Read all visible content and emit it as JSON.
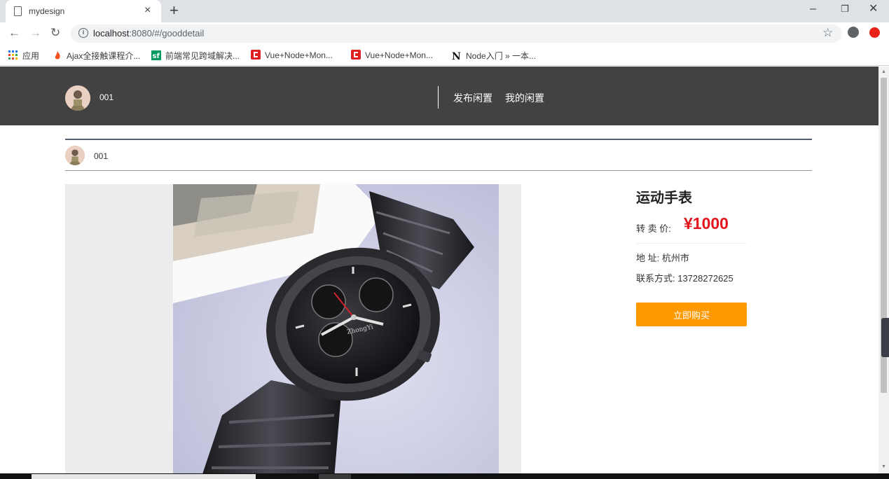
{
  "browser": {
    "tab_title": "mydesign",
    "url_host": "localhost",
    "url_path": ":8080/#/gooddetail",
    "bookmarks": [
      {
        "label": "应用",
        "icon": "apps-grid-icon",
        "color": "#1a73e8"
      },
      {
        "label": "Ajax全接触课程介...",
        "icon": "flame-icon",
        "color": "#f4511e"
      },
      {
        "label": "前端常见跨域解决...",
        "icon": "sf-icon",
        "color": "#009a61"
      },
      {
        "label": "Vue+Node+Mon...",
        "icon": "c-logo-icon",
        "color": "#e02020"
      },
      {
        "label": "Vue+Node+Mon...",
        "icon": "c-logo-icon",
        "color": "#e02020"
      },
      {
        "label": "Node入门 » 一本...",
        "icon": "n-logo-icon",
        "color": "#111111"
      }
    ]
  },
  "header": {
    "username": "001",
    "nav": [
      "发布闲置",
      "我的闲置"
    ]
  },
  "seller": {
    "name": "001"
  },
  "product": {
    "title": "运动手表",
    "price_label": "转 卖 价:",
    "price": "¥1000",
    "address": "地 址:  杭州市",
    "contact": "联系方式: 13728272625",
    "buy_label": "立即购买"
  },
  "colors": {
    "header_bg": "#424242",
    "price": "#e4141c",
    "buy_button": "#ff9900"
  }
}
